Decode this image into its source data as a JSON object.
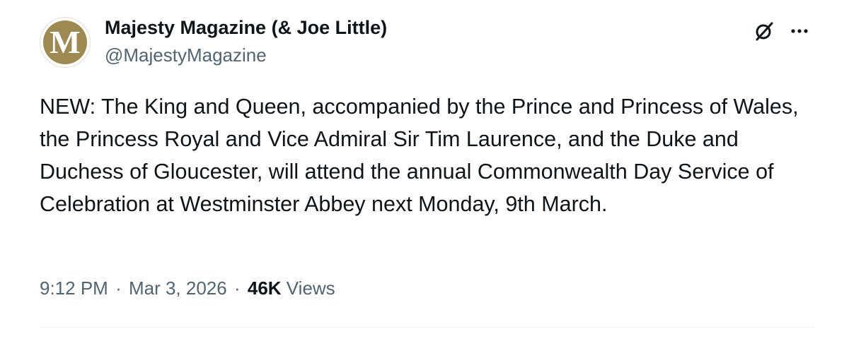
{
  "tweet": {
    "author_name": "Majesty Magazine (& Joe Little)",
    "author_handle": "@MajestyMagazine",
    "avatar_letter": "M",
    "text": "NEW: The King and Queen, accompanied by the Prince and Princess of Wales, the Princess Royal and Vice Admiral Sir Tim Laurence, and the Duke and Duchess of Gloucester, will attend the annual Commonwealth Day Service of Celebration at Westminster Abbey next Monday, 9th March.",
    "time": "9:12 PM",
    "date": "Mar 3, 2026",
    "separator": "·",
    "views_count": "46K",
    "views_label": "Views"
  },
  "icons": {
    "grok": "grok-icon",
    "more": "more-icon"
  },
  "colors": {
    "avatar_gold": "#9c8a52",
    "text_primary": "#0f1419",
    "text_secondary": "#536471",
    "divider": "#eff3f4"
  }
}
